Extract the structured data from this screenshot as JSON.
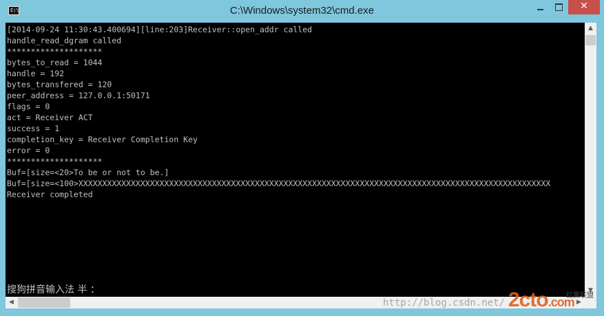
{
  "window": {
    "title": "C:\\Windows\\system32\\cmd.exe",
    "icon_label": "C:\\",
    "minimize_glyph": "minimize-icon",
    "maximize_glyph": "maximize-icon",
    "close_glyph": "✕"
  },
  "console": {
    "lines": [
      "[2014-09-24 11:30:43.400694][line:203]Receiver::open_addr called",
      "handle_read_dgram called",
      "********************",
      "bytes_to_read = 1044",
      "handle = 192",
      "bytes_transfered = 120",
      "peer_address = 127.0.0.1:50171",
      "flags = 0",
      "act = Receiver ACT",
      "success = 1",
      "completion_key = Receiver Completion Key",
      "error = 0",
      "********************",
      "Buf=[size=<20>To be or not to be.]",
      "Buf=[size=<100>XXXXXXXXXXXXXXXXXXXXXXXXXXXXXXXXXXXXXXXXXXXXXXXXXXXXXXXXXXXXXXXXXXXXXXXXXXXXXXXXXXXXXXXXXXXXXXXXXXX",
      "Receiver completed"
    ],
    "ime_status": "搜狗拼音输入法 半 ："
  },
  "scrollbars": {
    "up_arrow": "▲",
    "down_arrow": "▼",
    "left_arrow": "◀",
    "right_arrow": "▶"
  },
  "watermark": {
    "url": "http://blog.csdn.net/",
    "logo": "2cto",
    "logo_suffix": ".com",
    "sub": "红黑联盟"
  },
  "colors": {
    "titlebar": "#7fc7dd",
    "console_bg": "#000000",
    "console_fg": "#c0c0c0",
    "close_button": "#c7504a"
  }
}
